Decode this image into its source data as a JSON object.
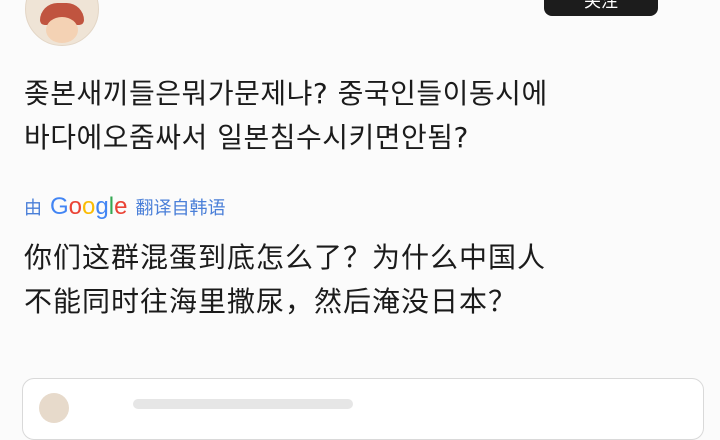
{
  "header": {
    "follow_label": "关注"
  },
  "post": {
    "original_lines": [
      "좆본새끼들은뭐가문제냐? 중국인들이동시에",
      "바다에오줌싸서 일본침수시키면안됨?"
    ],
    "translation_prefix": "由",
    "translation_brand": [
      "G",
      "o",
      "o",
      "g",
      "l",
      "e"
    ],
    "translation_suffix": "翻译自韩语",
    "translated_lines": [
      "你们这群混蛋到底怎么了？为什么中国人",
      "不能同时往海里撒尿，然后淹没日本？"
    ]
  },
  "colors": {
    "google": [
      "#4285F4",
      "#EA4335",
      "#FBBC05",
      "#4285F4",
      "#34A853",
      "#EA4335"
    ],
    "link": "#4a7fd8",
    "text": "#1b1b1b"
  }
}
